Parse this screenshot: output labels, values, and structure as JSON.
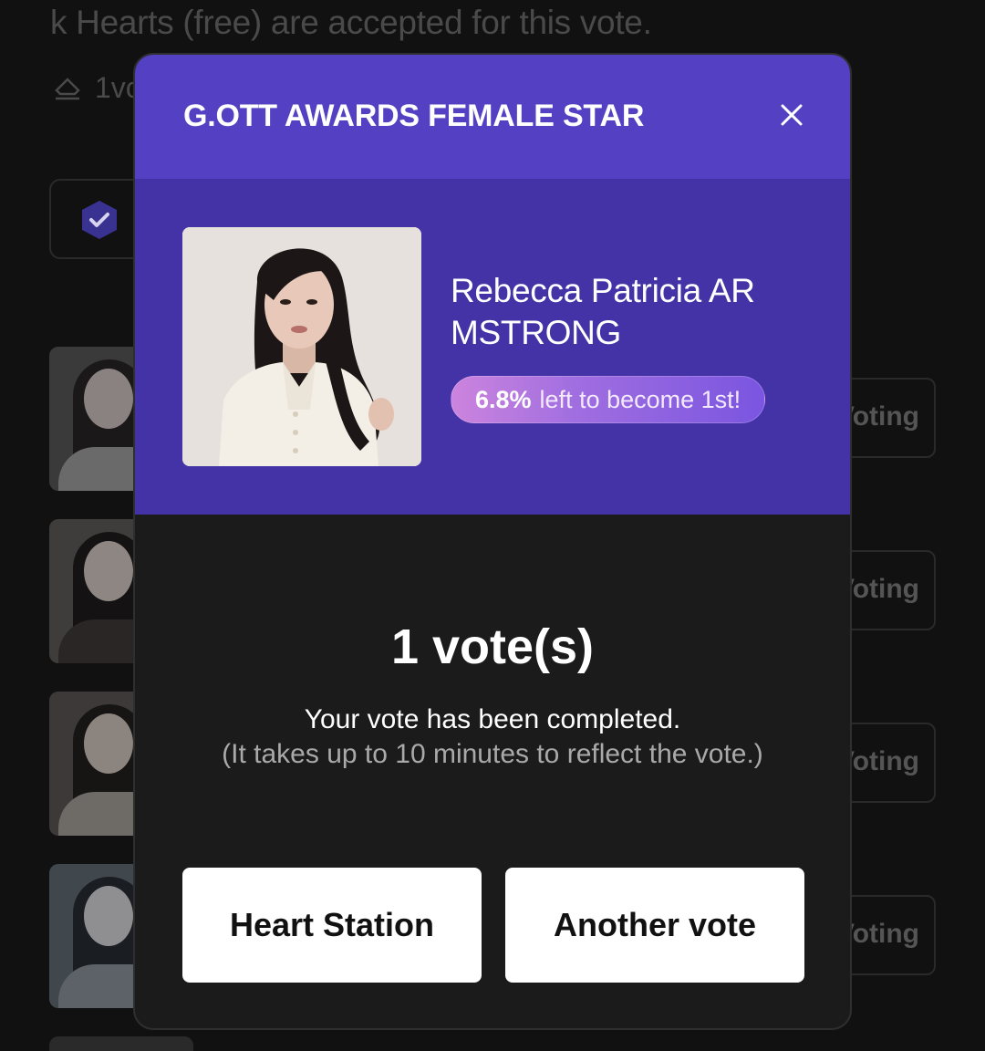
{
  "background": {
    "notice": "k Hearts (free) are accepted for this vote.",
    "vote_count_label": "1vc",
    "rows": [
      {
        "button_label": "Voting",
        "thumb_bg": "#3a3a3a",
        "body_color": "#d8d8d8"
      },
      {
        "button_label": "Voting",
        "thumb_bg": "#3f3c3c",
        "body_color": "#2a2626"
      },
      {
        "button_label": "Voting",
        "thumb_bg": "#3d3939",
        "body_color": "#e8e2da"
      },
      {
        "button_label": "Voting",
        "thumb_bg": "#40474d",
        "body_color": "#cfd6dc"
      }
    ]
  },
  "modal": {
    "title": "G.OTT AWARDS FEMALE STAR",
    "close_icon": "close-icon",
    "candidate": {
      "name": "Rebecca Patricia AR MSTRONG",
      "rank_percent": "6.8%",
      "rank_text": "left to become 1st!"
    },
    "result": {
      "votes": "1 vote(s)",
      "message": "Your vote has been completed.",
      "note": "(It takes up to 10 minutes to reflect the vote.)"
    },
    "buttons": {
      "heart_station": "Heart Station",
      "another_vote": "Another vote"
    }
  },
  "colors": {
    "header": "#5440c2",
    "candidate_panel": "#4333a6",
    "modal_body": "#1b1b1b",
    "pill_start": "#cc84de",
    "pill_end": "#7a55e0"
  }
}
